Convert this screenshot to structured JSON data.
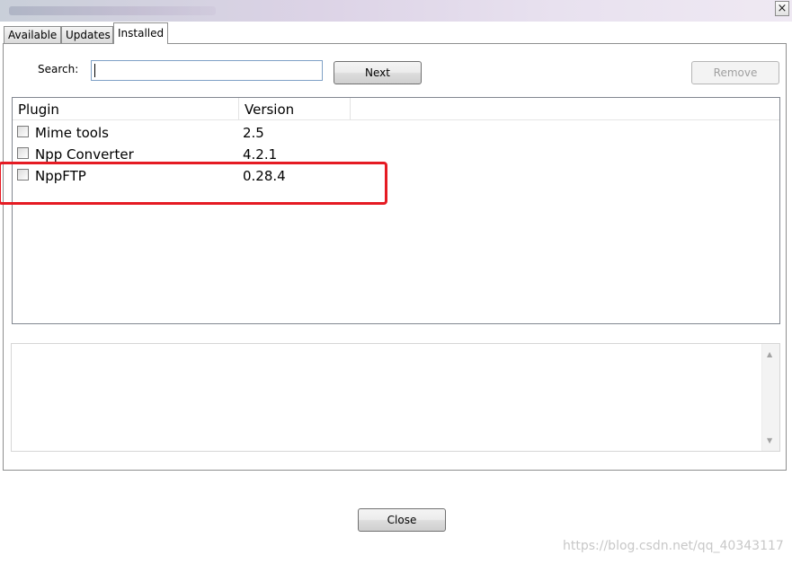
{
  "window": {
    "title": "",
    "close_glyph": "×"
  },
  "tabs": [
    {
      "label": "Available",
      "active": false
    },
    {
      "label": "Updates",
      "active": false
    },
    {
      "label": "Installed",
      "active": true
    }
  ],
  "search": {
    "label": "Search:",
    "value": "",
    "placeholder": ""
  },
  "buttons": {
    "next": "Next",
    "remove": "Remove",
    "close": "Close"
  },
  "list": {
    "columns": [
      "Plugin",
      "Version"
    ],
    "rows": [
      {
        "plugin": "Mime tools",
        "version": "2.5",
        "checked": false
      },
      {
        "plugin": "Npp Converter",
        "version": "4.2.1",
        "checked": false
      },
      {
        "plugin": "NppFTP",
        "version": "0.28.4",
        "checked": false
      }
    ]
  },
  "description": {
    "text": ""
  },
  "annotation": {
    "color": "#e51b23",
    "target": "NppFTP"
  },
  "watermark": "https://blog.csdn.net/qq_40343117",
  "icons": {
    "scroll_up": "scroll-up-arrow-icon",
    "scroll_down": "scroll-down-arrow-icon"
  }
}
